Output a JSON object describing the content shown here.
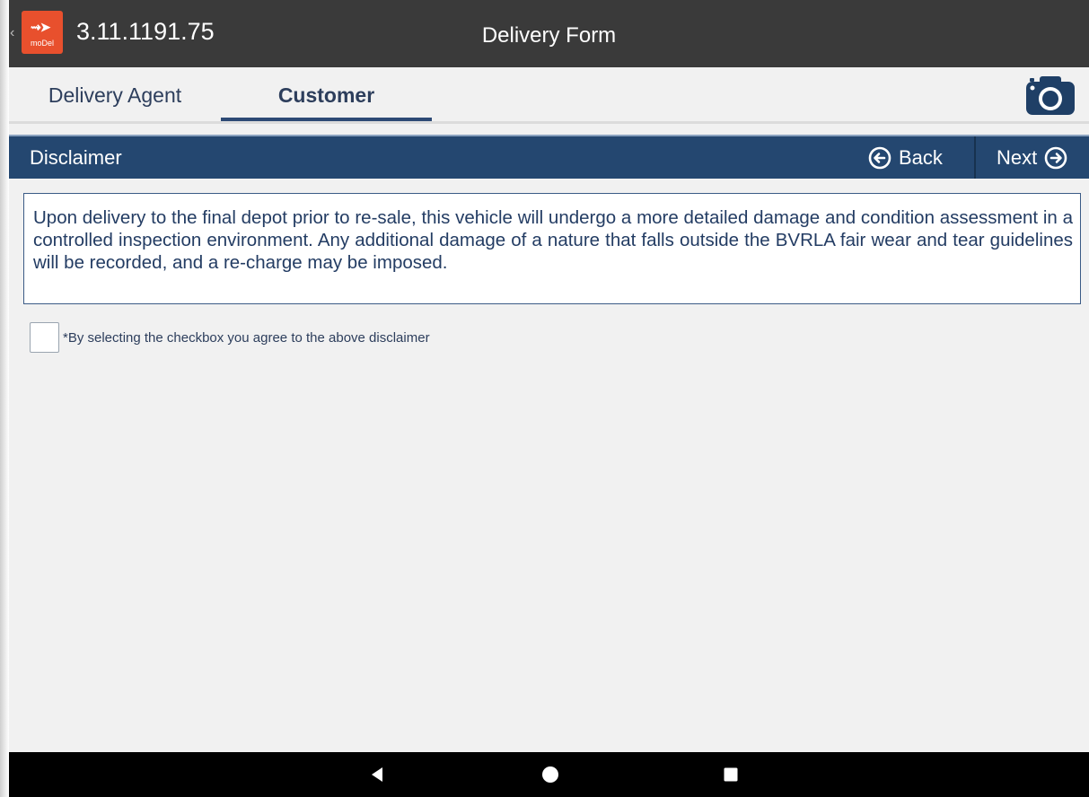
{
  "titlebar": {
    "logo_text": "moDel",
    "version": "3.11.1191.75",
    "title": "Delivery Form"
  },
  "tabs": [
    {
      "label": "Delivery Agent",
      "active": false
    },
    {
      "label": "Customer",
      "active": true
    }
  ],
  "section": {
    "title": "Disclaimer",
    "back_label": "Back",
    "next_label": "Next"
  },
  "disclaimer": {
    "text": "Upon delivery to the final depot prior to re-sale, this vehicle will undergo a more detailed damage and condition assessment in a controlled inspection environment. Any additional damage of a nature that falls outside the BVRLA fair wear and tear guidelines will be recorded, and a re-charge may be imposed."
  },
  "agreement": {
    "checked": false,
    "label": "*By selecting the checkbox you agree to the above disclaimer"
  },
  "icons": {
    "camera": "camera-icon",
    "back": "arrow-left-circle-icon",
    "next": "arrow-right-circle-icon",
    "nav_back": "triangle-back-icon",
    "nav_home": "circle-home-icon",
    "nav_recent": "square-recent-icon"
  },
  "colors": {
    "titlebar": "#3a3a3a",
    "accent": "#244770",
    "logo": "#e8502d",
    "text": "#233c63"
  }
}
